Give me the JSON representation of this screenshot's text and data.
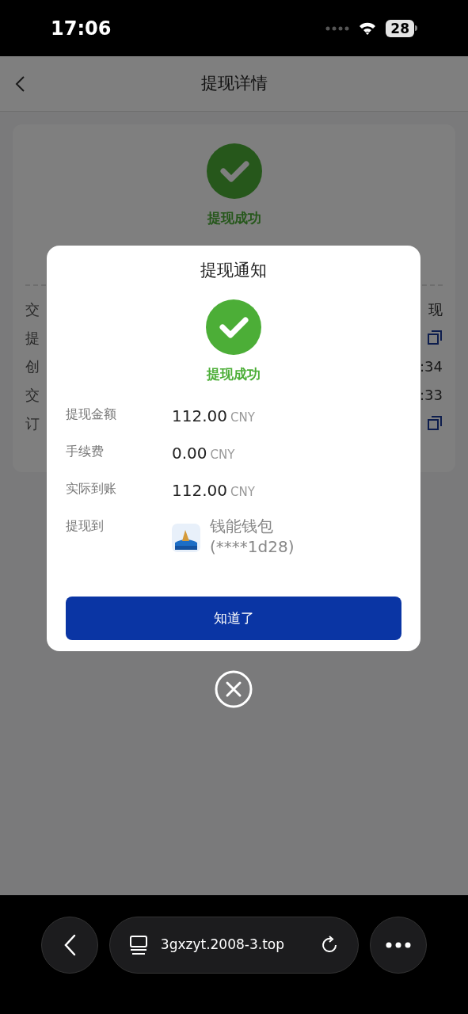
{
  "status_bar": {
    "time": "17:06",
    "battery": "28"
  },
  "header": {
    "title": "提现详情"
  },
  "page": {
    "status_text": "提现成功",
    "rows": [
      {
        "kind": "text",
        "label": "交",
        "value": "现"
      },
      {
        "kind": "copy",
        "label": "提"
      },
      {
        "kind": "text",
        "label": "创",
        "value": ":34"
      },
      {
        "kind": "text",
        "label": "交",
        "value": ":33"
      },
      {
        "kind": "copy",
        "label": "订"
      }
    ]
  },
  "dialog": {
    "title": "提现通知",
    "status_text": "提现成功",
    "rows": [
      {
        "kind": "amount",
        "label": "提现金额",
        "amount": "112.00",
        "unit": "CNY"
      },
      {
        "kind": "amount",
        "label": "手续费",
        "amount": "0.00",
        "unit": "CNY"
      },
      {
        "kind": "amount",
        "label": "实际到账",
        "amount": "112.00",
        "unit": "CNY"
      },
      {
        "kind": "wallet",
        "label": "提现到",
        "name": "钱能钱包",
        "account": "(****1d28)"
      }
    ],
    "button": "知道了"
  },
  "browser": {
    "url": "3gxzyt.2008-3.top"
  }
}
